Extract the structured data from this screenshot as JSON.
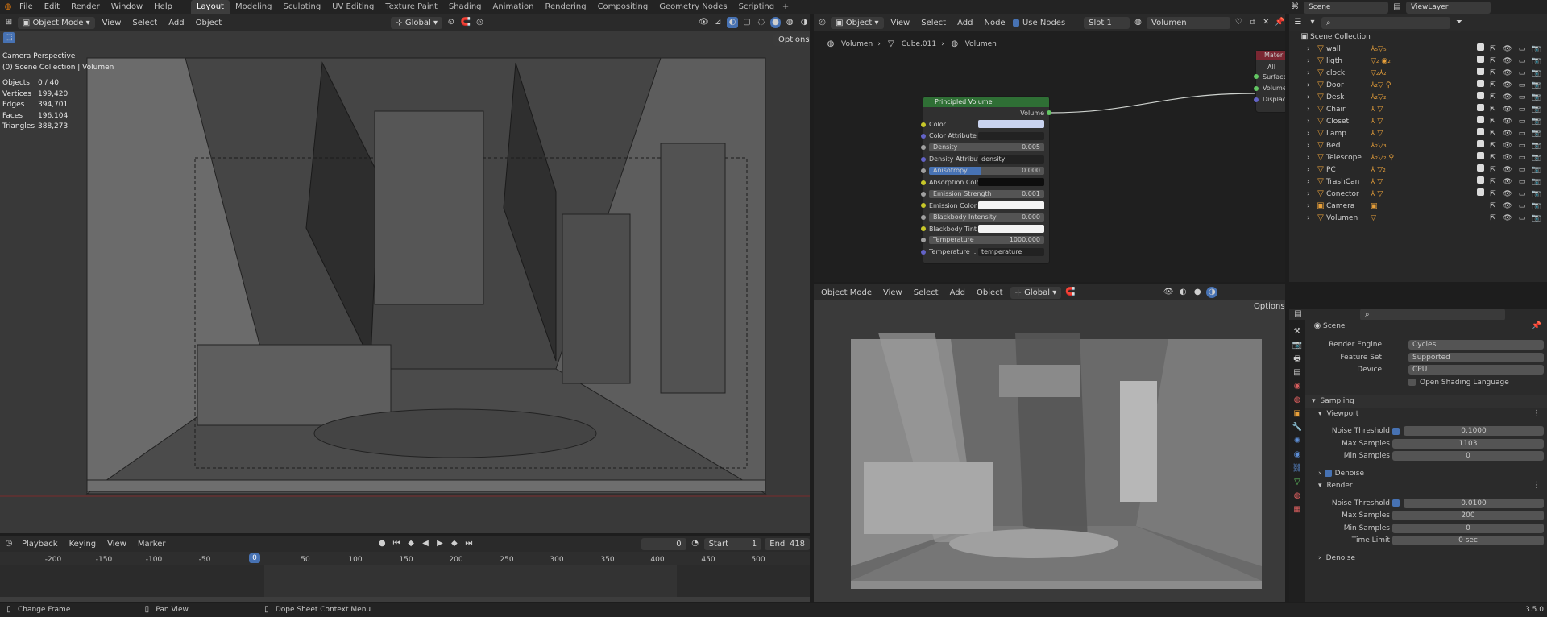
{
  "menu": [
    "File",
    "Edit",
    "Render",
    "Window",
    "Help"
  ],
  "workspaces": [
    "Layout",
    "Modeling",
    "Sculpting",
    "UV Editing",
    "Texture Paint",
    "Shading",
    "Animation",
    "Rendering",
    "Compositing",
    "Geometry Nodes",
    "Scripting"
  ],
  "top_right": {
    "scene": "Scene",
    "view_layer": "ViewLayer"
  },
  "viewport3d": {
    "mode": "Object Mode",
    "menus": [
      "View",
      "Select",
      "Add",
      "Object"
    ],
    "orientation": "Global",
    "options": "Options",
    "title": "Camera Perspective",
    "collection": "(0) Scene Collection | Volumen",
    "stats": [
      {
        "label": "Objects",
        "value": "0 / 40"
      },
      {
        "label": "Vertices",
        "value": "199,420"
      },
      {
        "label": "Edges",
        "value": "394,701"
      },
      {
        "label": "Faces",
        "value": "196,104"
      },
      {
        "label": "Triangles",
        "value": "388,273"
      }
    ]
  },
  "node_editor": {
    "type": "Object",
    "menus": [
      "View",
      "Select",
      "Add",
      "Node"
    ],
    "use_nodes": "Use Nodes",
    "slot": "Slot 1",
    "material": "Volumen",
    "breadcrumb": [
      "Volumen",
      "Cube.011",
      "Volumen"
    ],
    "output_node": {
      "title": "Mater",
      "target": "All",
      "sockets": [
        "Surface",
        "Volume",
        "Displace"
      ]
    },
    "principled": {
      "title": "Principled Volume",
      "output": "Volume",
      "rows": [
        {
          "label": "Color",
          "kind": "color",
          "swatch": "#c9d3ef"
        },
        {
          "label": "Color Attribute",
          "kind": "text",
          "value": ""
        },
        {
          "label": "Density",
          "kind": "num",
          "value": "0.005"
        },
        {
          "label": "Density Attribute",
          "kind": "text",
          "value": "density"
        },
        {
          "label": "Anisotropy",
          "kind": "num",
          "value": "0.000",
          "highlight": true
        },
        {
          "label": "Absorption Color",
          "kind": "color",
          "swatch": "#0e0e0e"
        },
        {
          "label": "Emission Strength",
          "kind": "num",
          "value": "0.001"
        },
        {
          "label": "Emission Color",
          "kind": "color",
          "swatch": "#f2f2f2"
        },
        {
          "label": "Blackbody Intensity",
          "kind": "num",
          "value": "0.000"
        },
        {
          "label": "Blackbody Tint",
          "kind": "color",
          "swatch": "#f2f2f2"
        },
        {
          "label": "Temperature",
          "kind": "num",
          "value": "1000.000"
        },
        {
          "label": "Temperature ...",
          "kind": "text",
          "value": "temperature"
        }
      ]
    }
  },
  "viewport_small": {
    "mode": "Object Mode",
    "menus": [
      "View",
      "Select",
      "Add",
      "Object"
    ],
    "orientation": "Global",
    "options": "Options"
  },
  "outliner": {
    "root": "Scene Collection",
    "items": [
      {
        "name": "wall",
        "icons": "⅄₅▽₅"
      },
      {
        "name": "ligth",
        "icons": "▽₂ ◉₂"
      },
      {
        "name": "clock",
        "icons": "▽₂⅄₂"
      },
      {
        "name": "Door",
        "icons": "⅄₂▽ ⚲"
      },
      {
        "name": "Desk",
        "icons": "⅄₂▽₂"
      },
      {
        "name": "Chair",
        "icons": "⅄ ▽"
      },
      {
        "name": "Closet",
        "icons": "⅄ ▽"
      },
      {
        "name": "Lamp",
        "icons": "⅄ ▽"
      },
      {
        "name": "Bed",
        "icons": "⅄₂▽₃"
      },
      {
        "name": "Telescope",
        "icons": "⅄₂▽₂ ⚲"
      },
      {
        "name": "PC",
        "icons": "⅄ ▽₂"
      },
      {
        "name": "TrashCan",
        "icons": "⅄ ▽"
      },
      {
        "name": "Conector",
        "icons": "⅄ ▽"
      },
      {
        "name": "Camera",
        "icons": "▣"
      },
      {
        "name": "Volumen",
        "icons": "▽"
      }
    ]
  },
  "properties": {
    "context": "Scene",
    "render_engine": {
      "label": "Render Engine",
      "value": "Cycles"
    },
    "feature_set": {
      "label": "Feature Set",
      "value": "Supported"
    },
    "device": {
      "label": "Device",
      "value": "CPU"
    },
    "osl": "Open Shading Language",
    "sampling": "Sampling",
    "viewport": {
      "title": "Viewport",
      "noise_threshold": {
        "label": "Noise Threshold",
        "value": "0.1000"
      },
      "max_samples": {
        "label": "Max Samples",
        "value": "1103"
      },
      "min_samples": {
        "label": "Min Samples",
        "value": "0"
      }
    },
    "denoise1": "Denoise",
    "render": {
      "title": "Render",
      "noise_threshold": {
        "label": "Noise Threshold",
        "value": "0.0100"
      },
      "max_samples": {
        "label": "Max Samples",
        "value": "200"
      },
      "min_samples": {
        "label": "Min Samples",
        "value": "0"
      },
      "time_limit": {
        "label": "Time Limit",
        "value": "0 sec"
      }
    },
    "denoise2": "Denoise"
  },
  "timeline": {
    "menus": [
      "Playback",
      "Keying",
      "View",
      "Marker"
    ],
    "current": "0",
    "start_label": "Start",
    "start": "1",
    "end_label": "End",
    "end": "418",
    "ticks": [
      "-200",
      "-150",
      "-100",
      "-50",
      "0",
      "50",
      "100",
      "150",
      "200",
      "250",
      "300",
      "350",
      "400",
      "450",
      "500"
    ],
    "playhead": "0"
  },
  "statusbar": {
    "change_frame": "Change Frame",
    "pan_view": "Pan View",
    "context_menu": "Dope Sheet Context Menu",
    "version": "3.5.0"
  }
}
